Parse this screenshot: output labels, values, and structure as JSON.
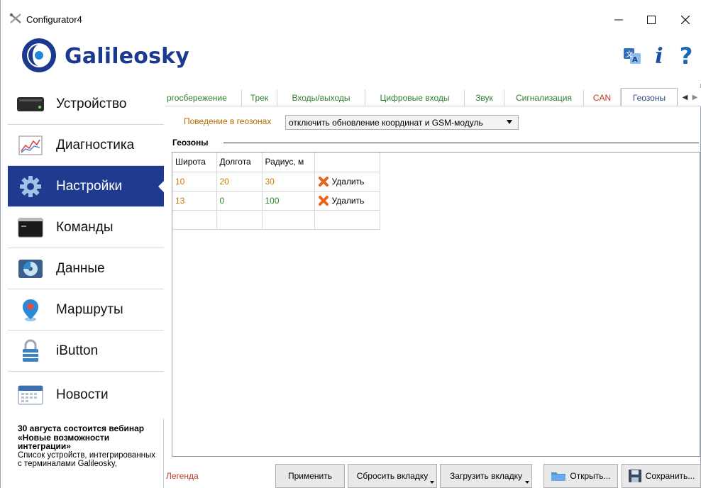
{
  "window": {
    "title": "Configurator4"
  },
  "brand": {
    "name": "Galileosky"
  },
  "sidebar": {
    "items": [
      {
        "label": "Устройство",
        "icon": "device-icon"
      },
      {
        "label": "Диагностика",
        "icon": "diagnostics-chart-icon"
      },
      {
        "label": "Настройки",
        "icon": "settings-gear-icon",
        "active": true
      },
      {
        "label": "Команды",
        "icon": "console-icon"
      },
      {
        "label": "Данные",
        "icon": "data-disk-icon"
      },
      {
        "label": "Маршруты",
        "icon": "map-pin-icon"
      },
      {
        "label": "iButton",
        "icon": "ibutton-lock-icon"
      },
      {
        "label": "Новости",
        "icon": "calendar-icon"
      }
    ],
    "news": {
      "title": "30 августа состоится вебинар «Новые возможности интеграции»",
      "body": "Список устройств, интегрированных с терминалами Galileosky,"
    }
  },
  "tabs": [
    {
      "label": "ргосбережение"
    },
    {
      "label": "Трек"
    },
    {
      "label": "Входы/выходы"
    },
    {
      "label": "Цифровые входы"
    },
    {
      "label": "Звук"
    },
    {
      "label": "Сигнализация"
    },
    {
      "label": "CAN"
    },
    {
      "label": "Геозоны",
      "active": true
    }
  ],
  "geozones": {
    "behaviour_label": "Поведение в геозонах",
    "behaviour_value": "отключить обновление координат и GSM-модуль",
    "group_label": "Геозоны",
    "columns": [
      "Широта",
      "Долгота",
      "Радиус, м",
      ""
    ],
    "rows": [
      {
        "lat": "10",
        "lon": "20",
        "radius": "30",
        "action": "Удалить"
      },
      {
        "lat": "13",
        "lon": "0",
        "radius": "100",
        "action": "Удалить"
      }
    ]
  },
  "footer": {
    "legend": "Легенда",
    "apply": "Применить",
    "reset_tab": "Сбросить вкладку",
    "load_tab": "Загрузить вкладку",
    "open": "Открыть...",
    "save": "Сохранить..."
  },
  "colors": {
    "accent": "#203a8f",
    "tab_green": "#2d7c2d",
    "tab_red": "#c0392b",
    "value_orange": "#cc7a00",
    "value_green": "#2c8a2c"
  }
}
